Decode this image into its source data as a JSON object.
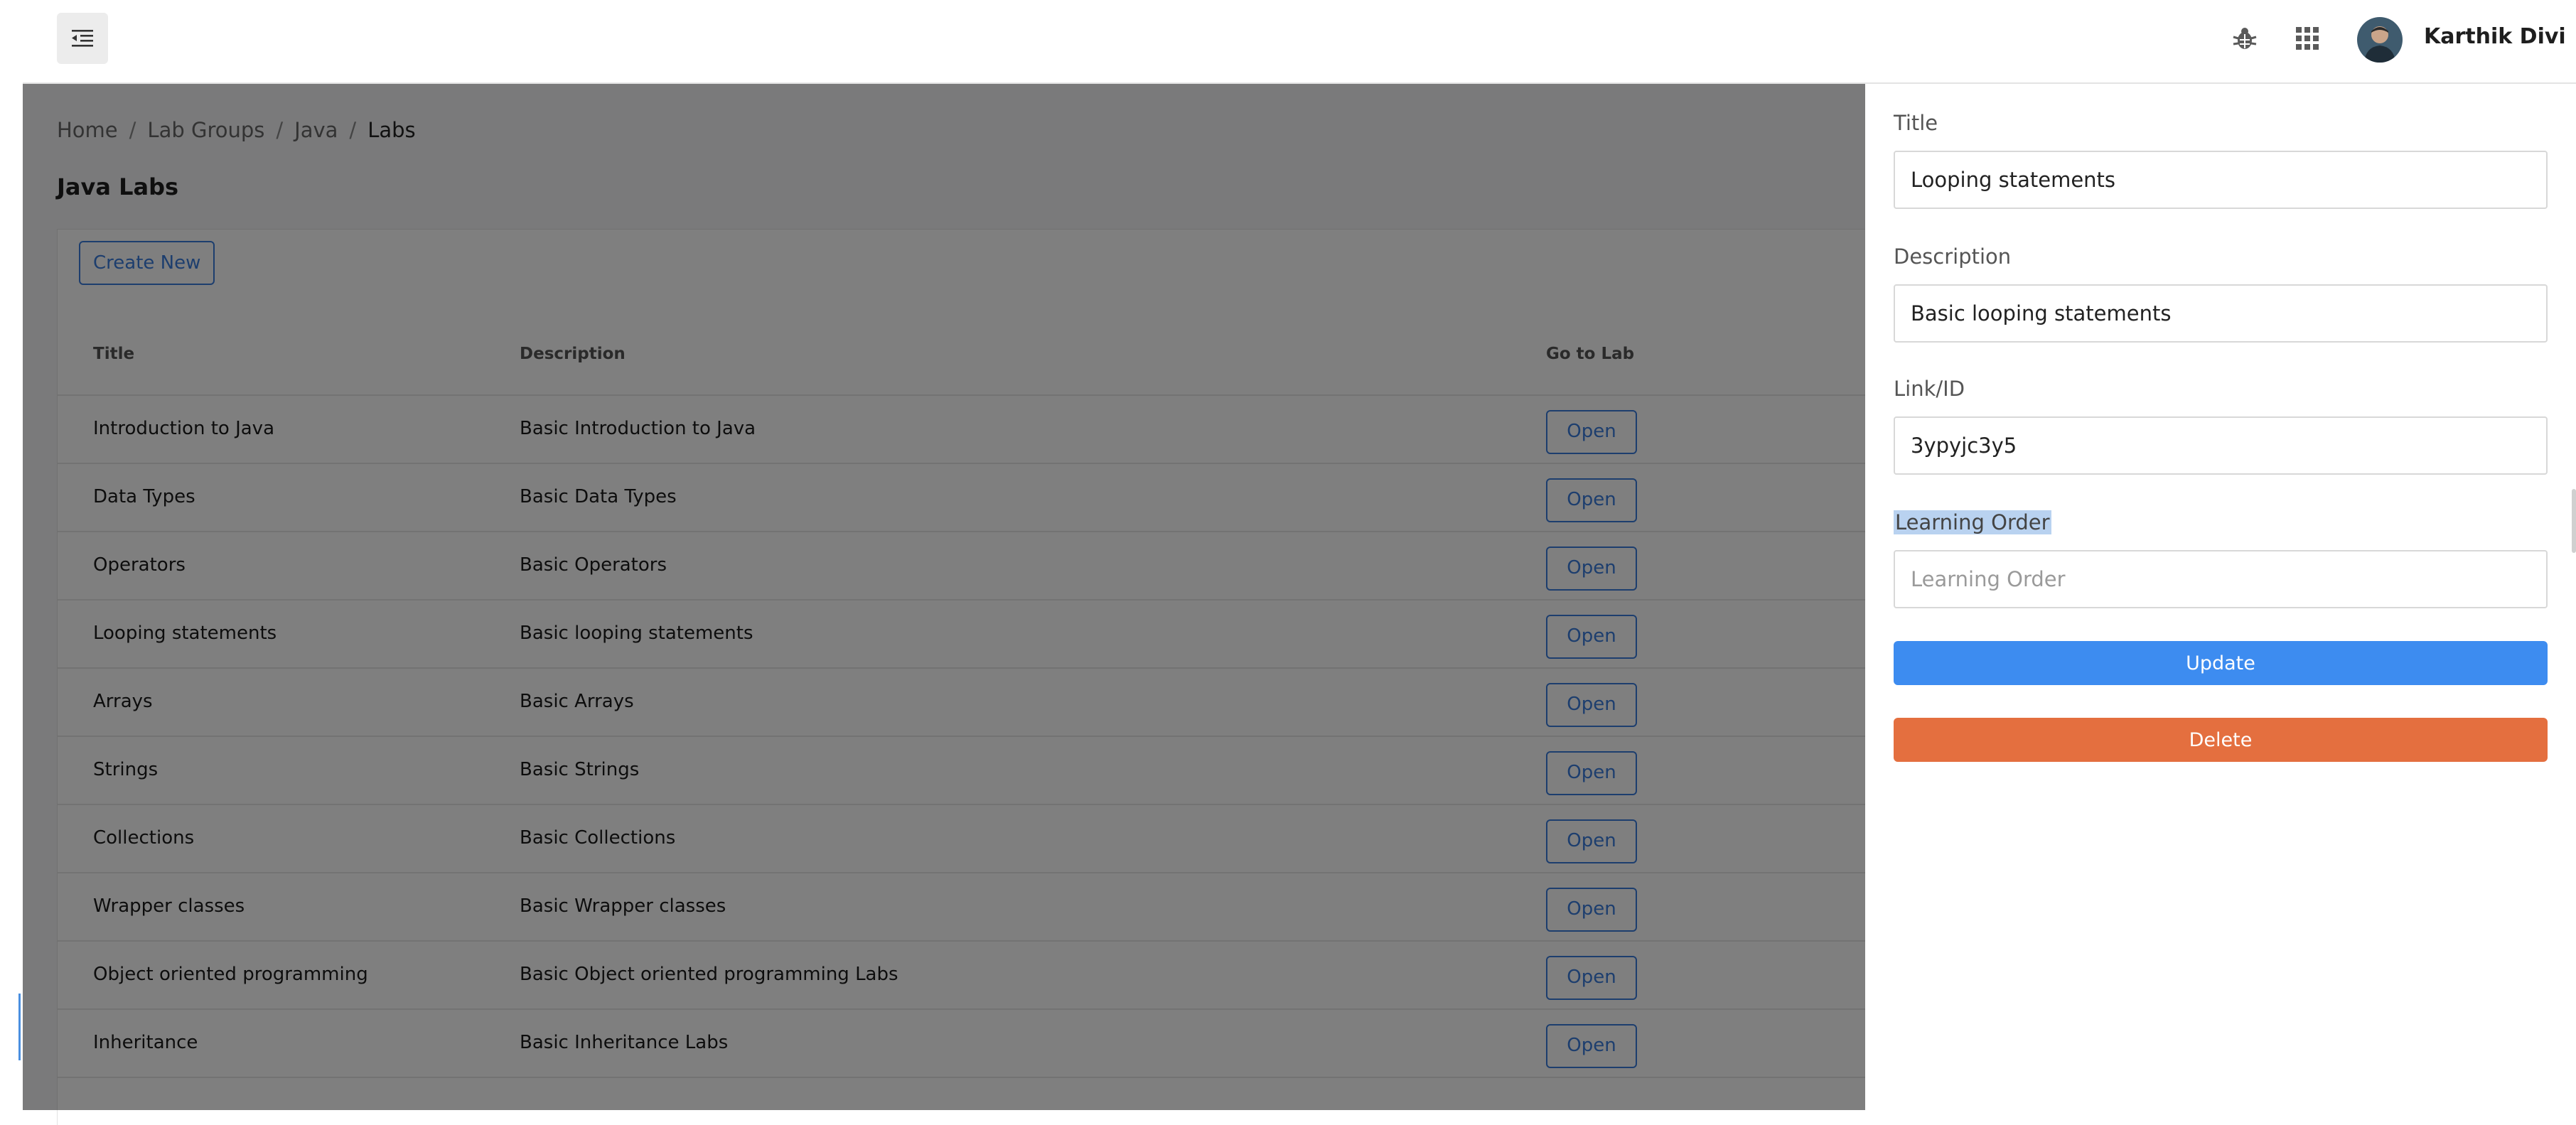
{
  "header": {
    "user_name": "Karthik Divi",
    "icons": [
      "menu-collapse-icon",
      "bug-icon",
      "apps-grid-icon",
      "user-avatar"
    ]
  },
  "breadcrumb": [
    "Home",
    "Lab Groups",
    "Java",
    "Labs"
  ],
  "page": {
    "title": "Java Labs",
    "create_label": "Create New"
  },
  "table": {
    "columns": [
      "Title",
      "Description",
      "Go to Lab"
    ],
    "open_label": "Open",
    "rows": [
      {
        "title": "Introduction to Java",
        "description": "Basic Introduction to Java"
      },
      {
        "title": "Data Types",
        "description": "Basic Data Types"
      },
      {
        "title": "Operators",
        "description": "Basic Operators"
      },
      {
        "title": "Looping statements",
        "description": "Basic looping statements"
      },
      {
        "title": "Arrays",
        "description": "Basic Arrays"
      },
      {
        "title": "Strings",
        "description": "Basic Strings"
      },
      {
        "title": "Collections",
        "description": "Basic Collections"
      },
      {
        "title": "Wrapper classes",
        "description": "Basic Wrapper classes"
      },
      {
        "title": "Object oriented programming",
        "description": "Basic Object oriented programming Labs"
      },
      {
        "title": "Inheritance",
        "description": "Basic Inheritance Labs"
      }
    ]
  },
  "panel": {
    "title_label": "Title",
    "title_value": "Looping statements",
    "description_label": "Description",
    "description_value": "Basic looping statements",
    "link_label": "Link/ID",
    "link_value": "3ypyjc3y5",
    "order_label": "Learning Order",
    "order_value": "",
    "order_placeholder": "Learning Order",
    "update_label": "Update",
    "delete_label": "Delete"
  },
  "colors": {
    "accent": "#3b7ddd",
    "update": "#3d8cf0",
    "delete": "#e46f3f"
  }
}
